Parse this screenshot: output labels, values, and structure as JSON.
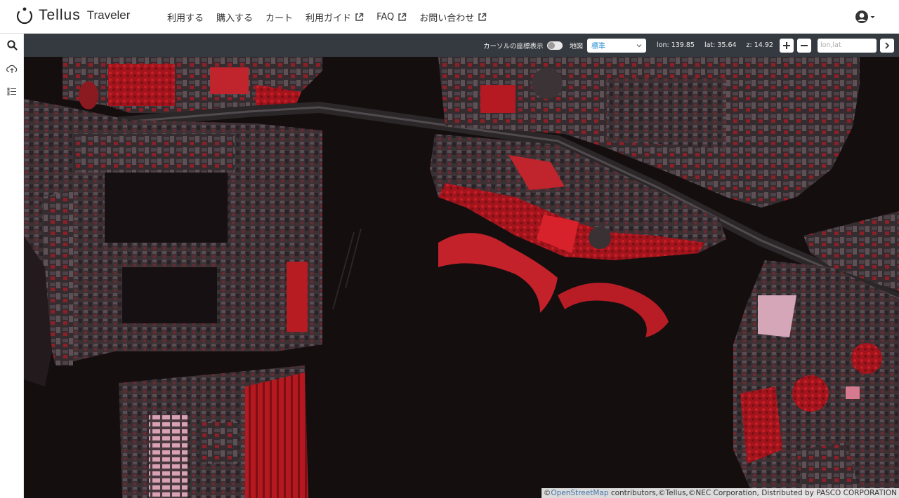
{
  "header": {
    "logo_text": "Tellus",
    "logo_sub": "Traveler",
    "nav": [
      {
        "label": "利用する",
        "external": false
      },
      {
        "label": "購入する",
        "external": false
      },
      {
        "label": "カート",
        "external": false
      },
      {
        "label": "利用ガイド",
        "external": true
      },
      {
        "label": "FAQ",
        "external": true
      },
      {
        "label": "お問い合わせ",
        "external": true
      }
    ],
    "user_icon": "user-circle-icon"
  },
  "sidebar": {
    "items": [
      {
        "icon": "search-icon"
      },
      {
        "icon": "cloud-upload-icon"
      },
      {
        "icon": "list-icon"
      }
    ]
  },
  "toolbar": {
    "cursor_coords_label": "カーソルの座標表示",
    "cursor_coords_enabled": false,
    "map_label": "地図",
    "map_select_value": "標準",
    "lon_text": "lon: 139.85",
    "lat_text": "lat: 35.64",
    "zoom_text": "z: 14.92",
    "coord_input_placeholder": "lon,lat"
  },
  "map": {
    "attribution_prefix": "©",
    "attribution_link": "OpenStreetMap",
    "attribution_rest": " contributors,©Tellus,©NEC Corporation, Distributed by PASCO CORPORATION",
    "colors": {
      "water": "#140e0f",
      "land": "#3a3034",
      "vegetation": "#b51a22",
      "bright_vegetation": "#d82028",
      "highway": "#4a4548"
    }
  }
}
